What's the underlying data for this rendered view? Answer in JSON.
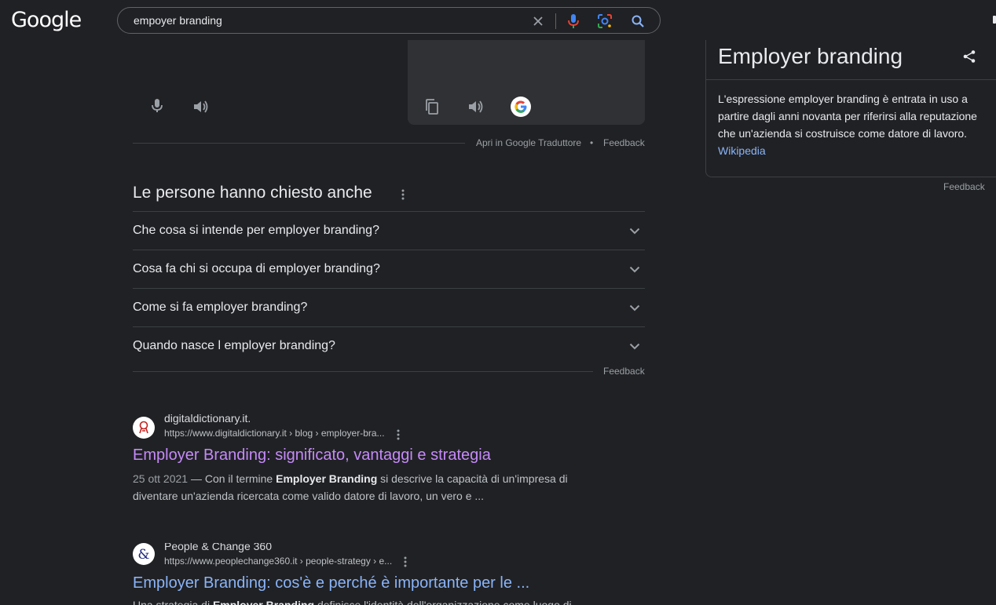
{
  "header": {
    "logo": "Google",
    "search_query": "empoyer branding"
  },
  "translator": {
    "open_translate": "Apri in Google Traduttore",
    "separator": "•",
    "feedback": "Feedback"
  },
  "paa": {
    "title": "Le persone hanno chiesto anche",
    "items": [
      "Che cosa si intende per employer branding?",
      "Cosa fa chi si occupa di employer branding?",
      "Come si fa employer branding?",
      "Quando nasce l employer branding?"
    ],
    "feedback": "Feedback"
  },
  "results": [
    {
      "site_name": "digitaldictionary.it.",
      "url": "https://www.digitaldictionary.it › blog › employer-bra...",
      "title": "Employer Branding: significato, vantaggi e strategia",
      "date": "25 ott 2021",
      "dash": " — Con il termine ",
      "bold1": "Employer Branding",
      "rest1": " si descrive la capacità di un'impresa di diventare un'azienda ricercata come valido datore di lavoro, un vero e ..."
    },
    {
      "site_name": "People & Change 360",
      "url": "https://www.peoplechange360.it › people-strategy › e...",
      "title": "Employer Branding: cos'è e perché è importante per le ...",
      "pre": "Una strategia di ",
      "bold1": "Employer Branding",
      "rest1": " definisce l'identità dell'organizzazione come luogo di"
    }
  ],
  "knowledge_panel": {
    "title": "Employer branding",
    "description": "L'espressione employer branding è entrata in uso a partire dagli anni novanta per riferirsi alla reputazione che un'azienda si costruisce come datore di lavoro.",
    "source": "Wikipedia",
    "feedback": "Feedback"
  },
  "colors": {
    "visited_link": "#c58af9",
    "link": "#8ab4f8",
    "background": "#202124"
  }
}
